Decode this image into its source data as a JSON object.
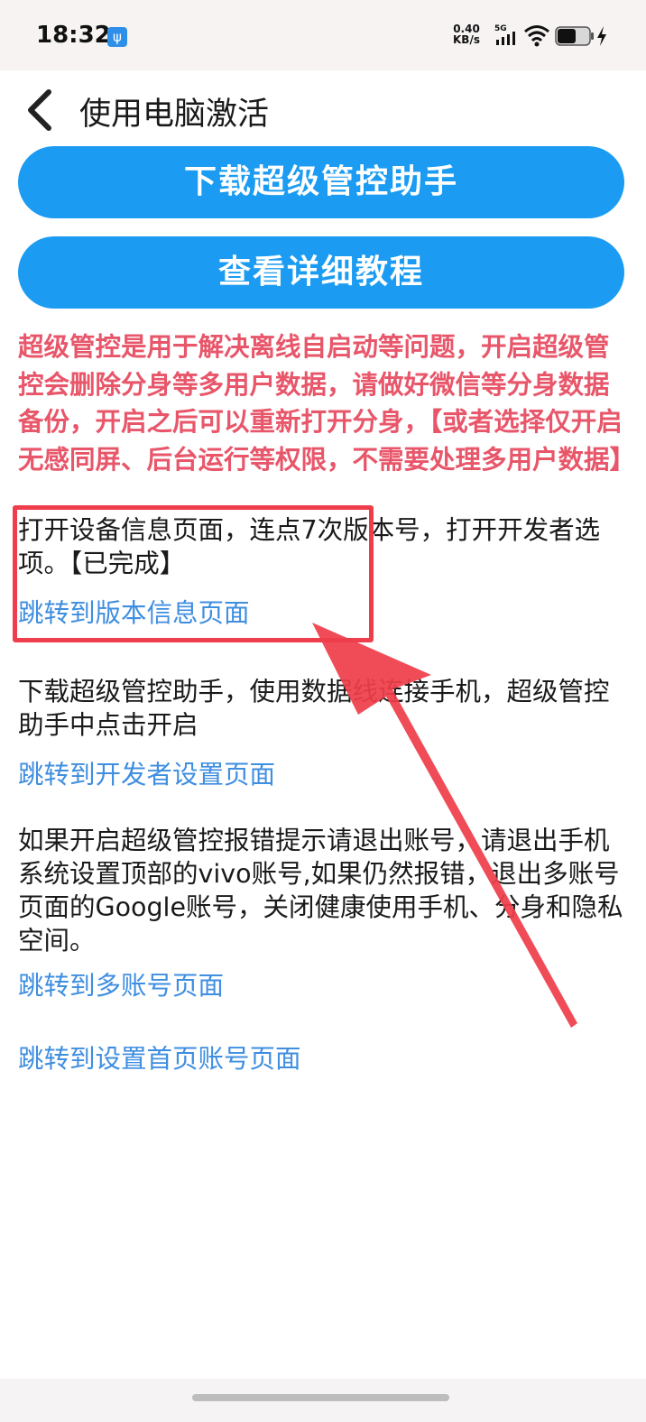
{
  "status_bar": {
    "time": "18:32",
    "net_speed_value": "0.40",
    "net_speed_unit": "KB/s",
    "network_type": "5G",
    "icons": [
      "usb-icon",
      "signal-icon",
      "wifi-icon",
      "battery-icon",
      "charging-icon"
    ]
  },
  "header": {
    "back_icon": "chevron-left-icon",
    "title": "使用电脑激活"
  },
  "buttons": {
    "download_label": "下载超级管控助手",
    "tutorial_label": "查看详细教程"
  },
  "warning": "超级管控是用于解决离线自启动等问题，开启超级管控会删除分身等多用户数据，请做好微信等分身数据备份，开启之后可以重新打开分身，【或者选择仅开启无感同屏、后台运行等权限，不需要处理多用户数据】",
  "steps": [
    {
      "text": "打开设备信息页面，连点7次版本号，打开开发者选项。【已完成】",
      "link": "跳转到版本信息页面"
    },
    {
      "text": "下载超级管控助手，使用数据线连接手机，超级管控助手中点击开启",
      "link": "跳转到开发者设置页面"
    },
    {
      "text": "如果开启超级管控报错提示请退出账号，请退出手机系统设置顶部的vivo账号,如果仍然报错，退出多账号页面的Google账号，关闭健康使用手机、分身和隐私空间。",
      "link": "跳转到多账号页面"
    }
  ],
  "extra_link": "跳转到设置首页账号页面",
  "colors": {
    "button_blue": "#1b9cf2",
    "warning_red": "#e8566a",
    "link_blue": "#3f8ee0",
    "annotation_red": "#ef3e4b"
  }
}
